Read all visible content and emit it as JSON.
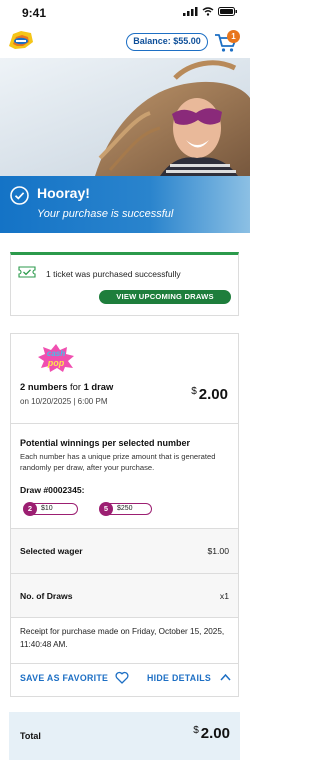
{
  "status": {
    "time": "9:41"
  },
  "header": {
    "balance_label": "Balance: $55.00",
    "cart_count": "1"
  },
  "banner": {
    "title": "Hooray!",
    "subtitle": "Your purchase is successful"
  },
  "confirmation": {
    "message": "1 ticket was purchased successfully",
    "button_label": "VIEW UPCOMING DRAWS"
  },
  "ticket": {
    "game_logo_text": "cash pop",
    "numbers_count": "2 numbers",
    "numbers_for": "for",
    "draws_count": "1 draw",
    "draw_datetime": "on 10/20/2025 | 6:00 PM",
    "price_symbol": "$",
    "price_amount": "2.00",
    "potential_title": "Potential winnings per selected number",
    "potential_desc": "Each number has a unique prize amount that is generated randomly per draw, after your purchase.",
    "draw_id": "Draw #0002345:",
    "picks": [
      {
        "number": "2",
        "amount": "$10"
      },
      {
        "number": "5",
        "amount": "$250"
      }
    ],
    "wager_label": "Selected wager",
    "wager_value": "$1.00",
    "draws_label": "No. of Draws",
    "draws_value": "x1",
    "receipt": "Receipt for purchase made on Friday, October 15, 2025, 11:40:48 AM.",
    "save_favorite": "SAVE AS FAVORITE",
    "hide_details": "HIDE DETAILS"
  },
  "total": {
    "label": "Total",
    "symbol": "$",
    "amount": "2.00"
  },
  "colors": {
    "brand_blue": "#1d6fc4",
    "success_green": "#1e7e3c",
    "pick_magenta": "#9c1f72",
    "cart_badge": "#e8761d"
  }
}
